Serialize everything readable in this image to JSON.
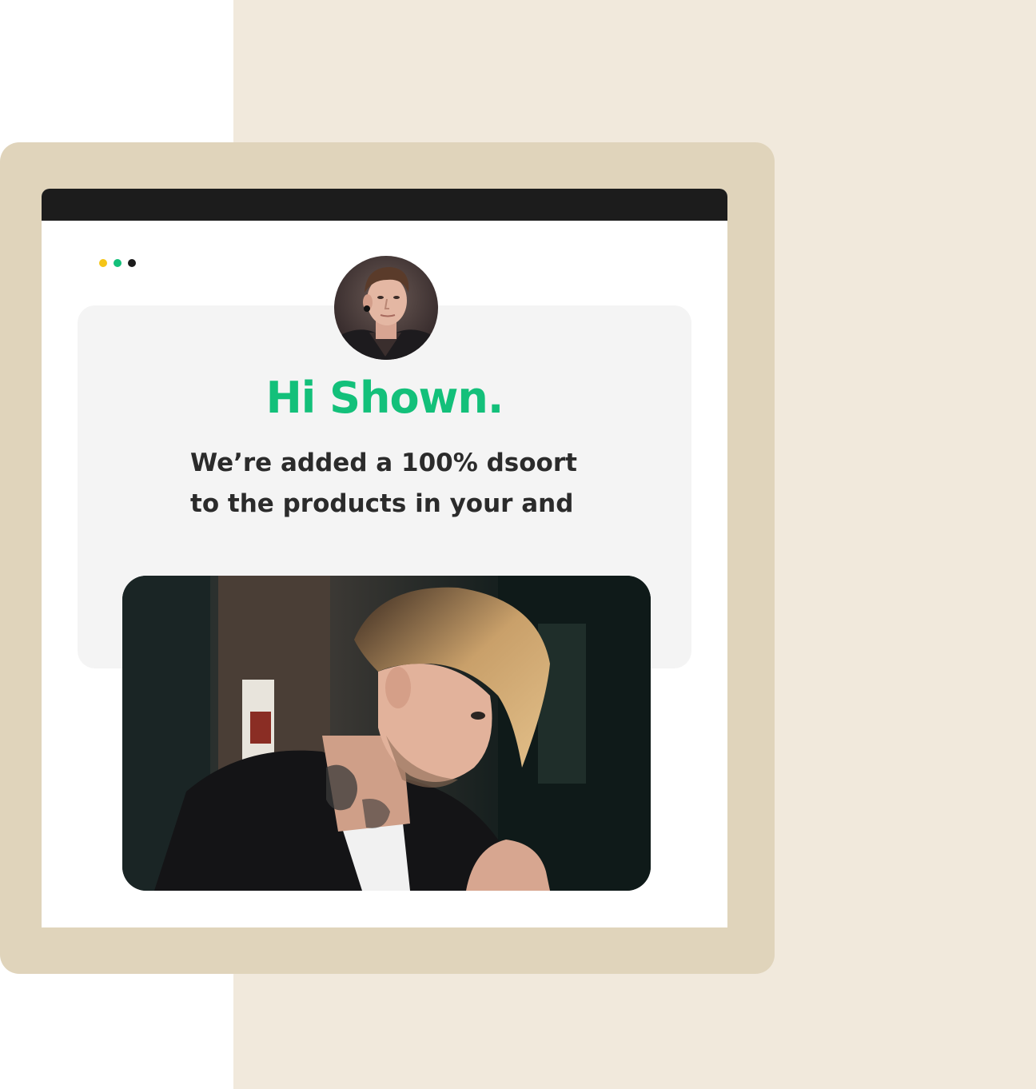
{
  "theme": {
    "accent": "#13c07a",
    "dot_colors": [
      "#f5c518",
      "#13c07a",
      "#1c1c1c"
    ],
    "frame_color": "#e0d4bb",
    "background_panel": "#f1e9dc",
    "title_bar": "#1c1c1c"
  },
  "window": {
    "dots": [
      "yellow-dot",
      "green-dot",
      "dark-dot"
    ]
  },
  "card": {
    "greeting": "Hi Shown.",
    "message_line_1": "We’re added a 100% dsoort",
    "message_line_2": "to the products in your and"
  },
  "images": {
    "avatar": "avatar-portrait",
    "hero": "tattooed-man-photo"
  }
}
